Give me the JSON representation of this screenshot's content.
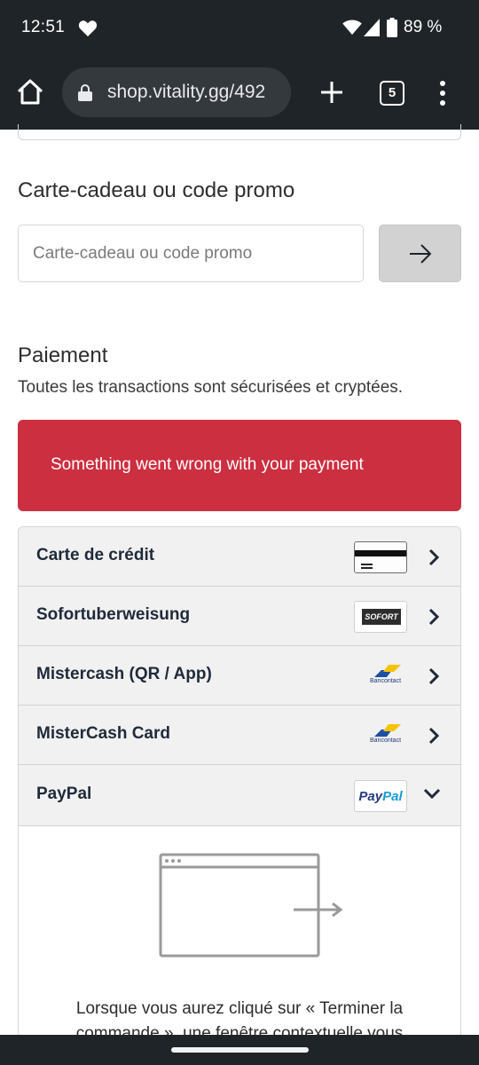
{
  "status_bar": {
    "time": "12:51",
    "battery_percent": "89 %",
    "icons": [
      "heart-icon",
      "wifi-icon",
      "signal-icon",
      "battery-icon"
    ]
  },
  "browser": {
    "url": "shop.vitality.gg/492",
    "tab_count": "5"
  },
  "promo": {
    "title": "Carte-cadeau ou code promo",
    "placeholder": "Carte-cadeau ou code promo",
    "value": ""
  },
  "payment": {
    "title": "Paiement",
    "subtitle": "Toutes les transactions sont sécurisées et cryptées.",
    "error": "Something went wrong with your payment",
    "methods": [
      {
        "label": "Carte de crédit",
        "logo": "credit-card-icon",
        "state": "collapsed"
      },
      {
        "label": "Sofortuberweisung",
        "logo": "sofort-logo",
        "logo_text": "SOFORT",
        "state": "collapsed"
      },
      {
        "label": "Mistercash (QR / App)",
        "logo": "bancontact-logo",
        "logo_text": "Bancontact",
        "state": "collapsed"
      },
      {
        "label": "MisterCash Card",
        "logo": "bancontact-logo",
        "logo_text": "Bancontact",
        "state": "collapsed"
      },
      {
        "label": "PayPal",
        "logo": "paypal-logo",
        "logo_text_a": "Pay",
        "logo_text_b": "Pal",
        "state": "expanded"
      }
    ],
    "paypal_note": "Lorsque vous aurez cliqué sur « Terminer la commande », une fenêtre contextuelle vous"
  },
  "colors": {
    "chrome_bg": "#1f2428",
    "error_bg": "#cc2f40",
    "method_bg": "#f1f1f1",
    "label_text": "#1f2a3a"
  }
}
